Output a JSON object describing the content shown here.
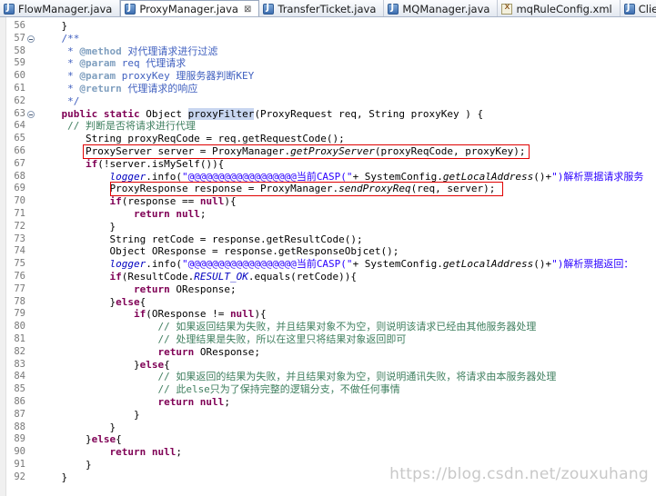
{
  "tabs": [
    {
      "label": "FlowManager.java",
      "icon": "java-file-icon",
      "active": false,
      "closable": false
    },
    {
      "label": "ProxyManager.java",
      "icon": "java-file-icon",
      "active": true,
      "closable": true
    },
    {
      "label": "TransferTicket.java",
      "icon": "java-file-icon",
      "active": false,
      "closable": false
    },
    {
      "label": "MQManager.java",
      "icon": "java-file-icon",
      "active": false,
      "closable": false
    },
    {
      "label": "mqRuleConfig.xml",
      "icon": "xml-file-icon",
      "active": false,
      "closable": false
    },
    {
      "label": "ClientSoftServ",
      "icon": "java-file-icon",
      "active": false,
      "closable": false
    }
  ],
  "close_glyph": "⊠",
  "watermark": "https://blog.csdn.net/zouxuhang",
  "highlight_color": "#e00000",
  "code_lines": [
    {
      "n": "56",
      "fold": false,
      "parts": [
        {
          "t": "    }",
          "c": ""
        }
      ]
    },
    {
      "n": "57",
      "fold": false,
      "parts": [
        {
          "t": "",
          "c": ""
        }
      ]
    },
    {
      "n": "57",
      "fold": true,
      "parts": [
        {
          "t": "    /**",
          "c": "jd"
        }
      ]
    },
    {
      "n": "58",
      "fold": false,
      "parts": [
        {
          "t": "     * ",
          "c": "jd"
        },
        {
          "t": "@method",
          "c": "tag"
        },
        {
          "t": " 对代理请求进行过滤",
          "c": "jd"
        }
      ]
    },
    {
      "n": "59",
      "fold": false,
      "parts": [
        {
          "t": "     * ",
          "c": "jd"
        },
        {
          "t": "@param",
          "c": "tag"
        },
        {
          "t": " req 代理请求",
          "c": "jd"
        }
      ]
    },
    {
      "n": "60",
      "fold": false,
      "parts": [
        {
          "t": "     * ",
          "c": "jd"
        },
        {
          "t": "@param",
          "c": "tag"
        },
        {
          "t": " proxyKey 理服务器判断KEY",
          "c": "jd"
        }
      ]
    },
    {
      "n": "61",
      "fold": false,
      "parts": [
        {
          "t": "     * ",
          "c": "jd"
        },
        {
          "t": "@return",
          "c": "tag"
        },
        {
          "t": " 代理请求的响应",
          "c": "jd"
        }
      ]
    },
    {
      "n": "62",
      "fold": false,
      "parts": [
        {
          "t": "     */",
          "c": "jd"
        }
      ]
    },
    {
      "n": "63",
      "fold": true,
      "parts": [
        {
          "t": "    ",
          "c": ""
        },
        {
          "t": "public static",
          "c": "kw"
        },
        {
          "t": " Object ",
          "c": ""
        },
        {
          "t": "proxyFilter",
          "c": "hl"
        },
        {
          "t": "(ProxyRequest req, String proxyKey ) {",
          "c": ""
        }
      ]
    },
    {
      "n": "64",
      "fold": false,
      "parts": [
        {
          "t": "     // 判断是否将请求进行代理",
          "c": "cm"
        }
      ]
    },
    {
      "n": "65",
      "fold": false,
      "parts": [
        {
          "t": "        String proxyReqCode = req.getRequestCode();",
          "c": ""
        }
      ]
    },
    {
      "n": "66",
      "fold": false,
      "parts": [
        {
          "t": "        ProxyServer server = ProxyManager.",
          "c": ""
        },
        {
          "t": "getProxyServer",
          "c": "it"
        },
        {
          "t": "(proxyReqCode, proxyKey);",
          "c": ""
        }
      ]
    },
    {
      "n": "67",
      "fold": false,
      "parts": [
        {
          "t": "        ",
          "c": ""
        },
        {
          "t": "if",
          "c": "kw"
        },
        {
          "t": "(!server.isMySelf()){",
          "c": ""
        }
      ]
    },
    {
      "n": "68",
      "fold": false,
      "parts": [
        {
          "t": "            ",
          "c": ""
        },
        {
          "t": "logger",
          "c": "fld"
        },
        {
          "t": ".info(",
          "c": ""
        },
        {
          "t": "\"@@@@@@@@@@@@@@@@@@当前CASP(\"",
          "c": "str"
        },
        {
          "t": "+ SystemConfig.",
          "c": ""
        },
        {
          "t": "getLocalAddress",
          "c": "it"
        },
        {
          "t": "()+",
          "c": ""
        },
        {
          "t": "\")解析票据请求服务",
          "c": "str"
        }
      ]
    },
    {
      "n": "69",
      "fold": false,
      "parts": [
        {
          "t": "            ProxyResponse response = ProxyManager.",
          "c": ""
        },
        {
          "t": "sendProxyReq",
          "c": "it"
        },
        {
          "t": "(req, server);",
          "c": ""
        }
      ]
    },
    {
      "n": "70",
      "fold": false,
      "parts": [
        {
          "t": "            ",
          "c": ""
        },
        {
          "t": "if",
          "c": "kw"
        },
        {
          "t": "(response == ",
          "c": ""
        },
        {
          "t": "null",
          "c": "kw"
        },
        {
          "t": "){",
          "c": ""
        }
      ]
    },
    {
      "n": "71",
      "fold": false,
      "parts": [
        {
          "t": "                ",
          "c": ""
        },
        {
          "t": "return null",
          "c": "kw"
        },
        {
          "t": ";",
          "c": ""
        }
      ]
    },
    {
      "n": "72",
      "fold": false,
      "parts": [
        {
          "t": "            }",
          "c": ""
        }
      ]
    },
    {
      "n": "73",
      "fold": false,
      "parts": [
        {
          "t": "            String retCode = response.getResultCode();",
          "c": ""
        }
      ]
    },
    {
      "n": "74",
      "fold": false,
      "parts": [
        {
          "t": "            Object OResponse = response.getResponseObjcet();",
          "c": ""
        }
      ]
    },
    {
      "n": "75",
      "fold": false,
      "parts": [
        {
          "t": "            ",
          "c": ""
        },
        {
          "t": "logger",
          "c": "fld"
        },
        {
          "t": ".info(",
          "c": ""
        },
        {
          "t": "\"@@@@@@@@@@@@@@@@@@当前CASP(\"",
          "c": "str"
        },
        {
          "t": "+ SystemConfig.",
          "c": ""
        },
        {
          "t": "getLocalAddress",
          "c": "it"
        },
        {
          "t": "()+",
          "c": ""
        },
        {
          "t": "\")解析票据返回：",
          "c": "str"
        }
      ]
    },
    {
      "n": "76",
      "fold": false,
      "parts": [
        {
          "t": "            ",
          "c": ""
        },
        {
          "t": "if",
          "c": "kw"
        },
        {
          "t": "(ResultCode.",
          "c": ""
        },
        {
          "t": "RESULT_OK",
          "c": "fld"
        },
        {
          "t": ".equals(retCode)){",
          "c": ""
        }
      ]
    },
    {
      "n": "77",
      "fold": false,
      "parts": [
        {
          "t": "                ",
          "c": ""
        },
        {
          "t": "return",
          "c": "kw"
        },
        {
          "t": " OResponse;",
          "c": ""
        }
      ]
    },
    {
      "n": "78",
      "fold": false,
      "parts": [
        {
          "t": "            }",
          "c": ""
        },
        {
          "t": "else",
          "c": "kw"
        },
        {
          "t": "{",
          "c": ""
        }
      ]
    },
    {
      "n": "79",
      "fold": false,
      "parts": [
        {
          "t": "                ",
          "c": ""
        },
        {
          "t": "if",
          "c": "kw"
        },
        {
          "t": "(OResponse != ",
          "c": ""
        },
        {
          "t": "null",
          "c": "kw"
        },
        {
          "t": "){",
          "c": ""
        }
      ]
    },
    {
      "n": "80",
      "fold": false,
      "parts": [
        {
          "t": "                    // 如果返回结果为失败，并且结果对象不为空，则说明该请求已经由其他服务器处理",
          "c": "cm"
        }
      ]
    },
    {
      "n": "81",
      "fold": false,
      "parts": [
        {
          "t": "                    // 处理结果是失败，所以在这里只将结果对象返回即可",
          "c": "cm"
        }
      ]
    },
    {
      "n": "82",
      "fold": false,
      "parts": [
        {
          "t": "                    ",
          "c": ""
        },
        {
          "t": "return",
          "c": "kw"
        },
        {
          "t": " OResponse;",
          "c": ""
        }
      ]
    },
    {
      "n": "83",
      "fold": false,
      "parts": [
        {
          "t": "                }",
          "c": ""
        },
        {
          "t": "else",
          "c": "kw"
        },
        {
          "t": "{",
          "c": ""
        }
      ]
    },
    {
      "n": "84",
      "fold": false,
      "parts": [
        {
          "t": "                    // 如果返回的结果为失败，并且结果对象为空，则说明通讯失败，将请求由本服务器处理",
          "c": "cm"
        }
      ]
    },
    {
      "n": "85",
      "fold": false,
      "parts": [
        {
          "t": "                    // 此else只为了保持完整的逻辑分支，不做任何事情",
          "c": "cm"
        }
      ]
    },
    {
      "n": "86",
      "fold": false,
      "parts": [
        {
          "t": "                    ",
          "c": ""
        },
        {
          "t": "return null",
          "c": "kw"
        },
        {
          "t": ";",
          "c": ""
        }
      ]
    },
    {
      "n": "87",
      "fold": false,
      "parts": [
        {
          "t": "                }",
          "c": ""
        }
      ]
    },
    {
      "n": "88",
      "fold": false,
      "parts": [
        {
          "t": "            }",
          "c": ""
        }
      ]
    },
    {
      "n": "89",
      "fold": false,
      "parts": [
        {
          "t": "        }",
          "c": ""
        },
        {
          "t": "else",
          "c": "kw"
        },
        {
          "t": "{",
          "c": ""
        }
      ]
    },
    {
      "n": "90",
      "fold": false,
      "parts": [
        {
          "t": "            ",
          "c": ""
        },
        {
          "t": "return null",
          "c": "kw"
        },
        {
          "t": ";",
          "c": ""
        }
      ]
    },
    {
      "n": "91",
      "fold": false,
      "parts": [
        {
          "t": "        }",
          "c": ""
        }
      ]
    },
    {
      "n": "92",
      "fold": false,
      "parts": [
        {
          "t": "    }",
          "c": ""
        }
      ]
    }
  ],
  "highlighted_lines": [
    "66",
    "69"
  ]
}
